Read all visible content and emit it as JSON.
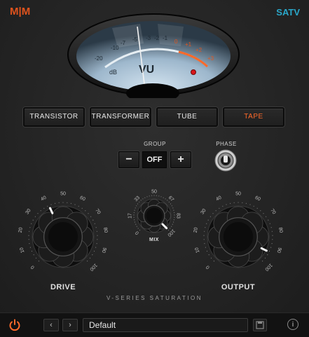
{
  "header": {
    "logo": "M|M",
    "product": "SATV"
  },
  "meter": {
    "title": "VU",
    "unit": "dB",
    "scale": [
      "-20",
      "-10",
      "-7",
      "-5",
      "-3",
      "-2",
      "-1",
      "0",
      "+1",
      "+2",
      "+3"
    ],
    "needle_db": -5
  },
  "modes": {
    "items": [
      {
        "label": "TRANSISTOR"
      },
      {
        "label": "TRANSFORMER"
      },
      {
        "label": "TUBE"
      },
      {
        "label": "TAPE"
      }
    ],
    "active_index": 3
  },
  "group": {
    "label": "GROUP",
    "minus": "−",
    "value": "OFF",
    "plus": "+"
  },
  "phase": {
    "label": "PHASE"
  },
  "knobs": {
    "drive": {
      "label": "DRIVE",
      "scale": [
        "0",
        "10",
        "20",
        "30",
        "40",
        "50",
        "60",
        "70",
        "80",
        "90",
        "100"
      ],
      "value": 41
    },
    "mix": {
      "label": "MIX",
      "scale": [
        "0",
        "17",
        "33",
        "50",
        "67",
        "83",
        "100"
      ],
      "value": 100
    },
    "output": {
      "label": "OUTPUT",
      "scale": [
        "0",
        "10",
        "20",
        "30",
        "40",
        "50",
        "60",
        "70",
        "80",
        "90",
        "100"
      ],
      "value": 93
    }
  },
  "footer_brand": "V-SERIES SATURATION",
  "footer": {
    "power_icon": "power-icon",
    "prev": "‹",
    "next": "›",
    "preset": "Default",
    "save_icon": "save-icon",
    "info": "i"
  },
  "colors": {
    "accent": "#ff6a2a",
    "brand_blue": "#2aa7c9",
    "meter_face": "#a9c2d6"
  }
}
